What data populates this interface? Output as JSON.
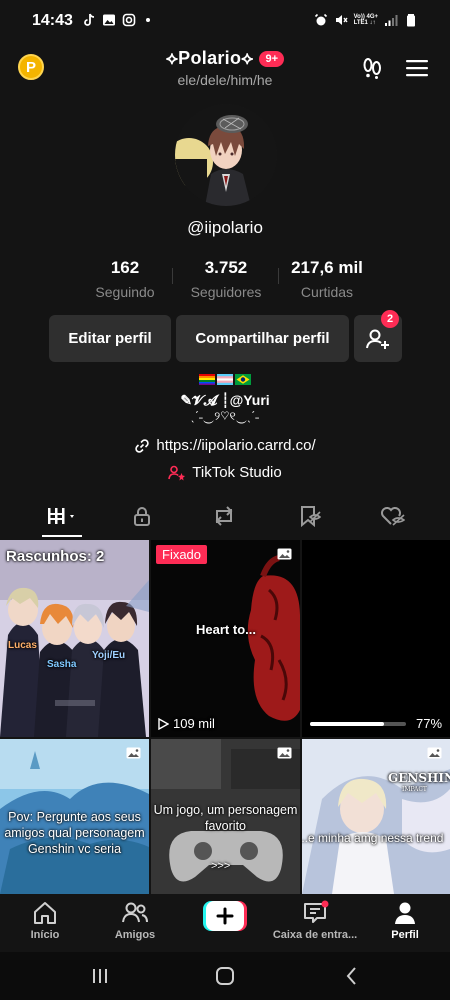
{
  "status_bar": {
    "time": "14:43",
    "network_top": "Vo)) 4G+",
    "network_bottom": "LTE1 ↓↑"
  },
  "header": {
    "coin_label": "P",
    "display_name": "⟡Polario⟡",
    "notification_badge": "9+",
    "pronouns": "ele/dele/him/he"
  },
  "profile": {
    "username": "@iipolario",
    "stats": [
      {
        "value": "162",
        "label": "Seguindo"
      },
      {
        "value": "3.752",
        "label": "Seguidores"
      },
      {
        "value": "217,6 mil",
        "label": "Curtidas"
      }
    ],
    "edit_label": "Editar perfil",
    "share_label": "Compartilhar perfil",
    "add_friends_badge": "2"
  },
  "bio": {
    "line2": "✎𝓥𝓐 ┊@Yuri",
    "line3": "ˎˊ˗‿୨♡୧‿ˎˊ˗",
    "link": "https://iipolario.carrd.co/",
    "studio": "TikTok Studio"
  },
  "videos": [
    {
      "overlay": "Rascunhos: 2",
      "names": [
        "Lucas",
        "Sasha",
        "Yoji/Eu"
      ]
    },
    {
      "pinned_label": "Fixado",
      "caption": "Heart to...",
      "views": "109 mil"
    },
    {
      "progress_label": "77%",
      "progress": 0.77
    },
    {
      "caption": "Pov: Pergunte aos seus amigos qual personagem Genshin vc seria"
    },
    {
      "caption": "Um jogo, um personagem favorito",
      "arrows": ">>>"
    },
    {
      "caption": "...e minha amg nessa trend",
      "logo": "GENSHIN",
      "logo_sub": "IMPACT"
    }
  ],
  "bottom_nav": [
    {
      "label": "Início"
    },
    {
      "label": "Amigos"
    },
    {
      "label": "Caixa de entra..."
    },
    {
      "label": "Perfil"
    }
  ],
  "colors": {
    "background": "#141414",
    "accent_pink": "#fe2c55",
    "accent_cyan": "#25f4ee",
    "button": "#2f2f2f"
  }
}
